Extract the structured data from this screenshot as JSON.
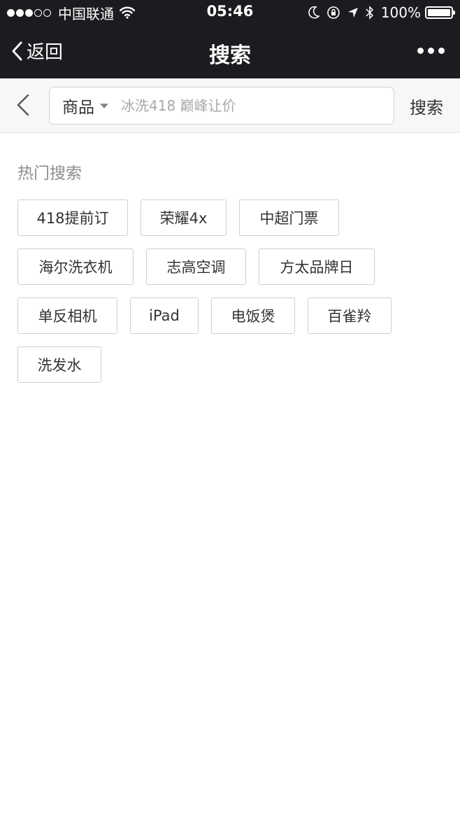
{
  "status_bar": {
    "carrier": "中国联通",
    "time": "05:46",
    "battery": "100%",
    "signal_level": 3,
    "signal_max": 5
  },
  "nav": {
    "back_label": "返回",
    "title": "搜索"
  },
  "search": {
    "category": "商品",
    "placeholder": "冰洗418 巅峰让价",
    "value": "",
    "submit_label": "搜索"
  },
  "hot_search": {
    "title": "热门搜索",
    "tags": [
      "418提前订",
      "荣耀4x",
      "中超门票",
      "海尔洗衣机",
      "志高空调",
      "方太品牌日",
      "单反相机",
      "iPad",
      "电饭煲",
      "百雀羚",
      "洗发水"
    ]
  },
  "colors": {
    "topbar": "#1c1c20",
    "searchbar_bg": "#f7f7f7",
    "tag_border": "#cfcfcf",
    "muted_text": "#8e8e8e"
  }
}
